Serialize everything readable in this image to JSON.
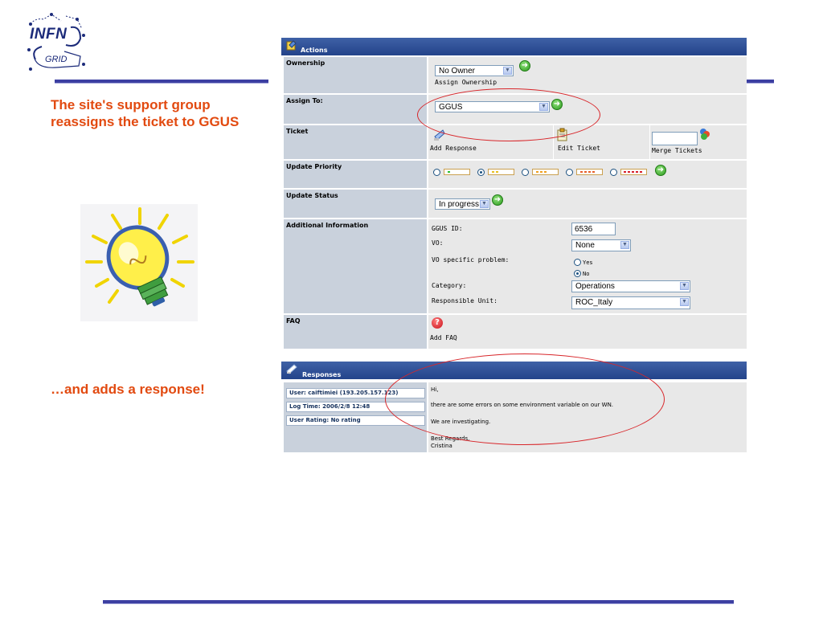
{
  "logo": {
    "top": "INFN",
    "bottom": "GRID"
  },
  "slide": {
    "caption1": "The site's support group reassigns the ticket to GGUS",
    "caption2": "…and adds a response!"
  },
  "actions_panel": {
    "title": "Actions",
    "ownership": {
      "label": "Ownership",
      "selected": "No Owner",
      "hint": "Assign Ownership"
    },
    "assign": {
      "label": "Assign To:",
      "selected": "GGUS"
    },
    "ticket": {
      "label": "Ticket",
      "add_response": "Add Response",
      "edit_ticket": "Edit Ticket",
      "merge_tickets": "Merge Tickets",
      "merge_value": ""
    },
    "priority": {
      "label": "Update Priority",
      "levels": 5,
      "selected_index": 1
    },
    "status": {
      "label": "Update Status",
      "selected": "In progress"
    },
    "additional": {
      "label": "Additional Information",
      "ggus_id_label": "GGUS ID:",
      "ggus_id": "6536",
      "vo_label": "VO:",
      "vo": "None",
      "vo_specific_label": "VO specific problem:",
      "yes": "Yes",
      "no": "No",
      "vo_specific_selected": "No",
      "category_label": "Category:",
      "category": "Operations",
      "responsible_label": "Responsible Unit:",
      "responsible": "ROC_Italy"
    },
    "faq": {
      "label": "FAQ",
      "add_faq": "Add FAQ"
    }
  },
  "responses_panel": {
    "title": "Responses",
    "user": "User: caiftimiei (193.205.157.123)",
    "log_time": "Log Time: 2006/2/8 12:48",
    "rating": "User Rating: No rating",
    "message": {
      "line1": "Hi,",
      "line2": "there are some errors on some environment variable on our WN.",
      "line3": "We are investigating.",
      "line4": "Best Regards,",
      "line5": "Cristina"
    }
  },
  "colors": {
    "accent": "#e24a10",
    "header": "#2f4f97",
    "rule": "#3c3fa2",
    "annotation": "#d8262a"
  },
  "icons": [
    "actions-icon",
    "go-arrow-icon",
    "add-response-icon",
    "edit-ticket-icon",
    "merge-tickets-icon",
    "faq-question-icon",
    "responses-icon",
    "lightbulb-icon"
  ]
}
